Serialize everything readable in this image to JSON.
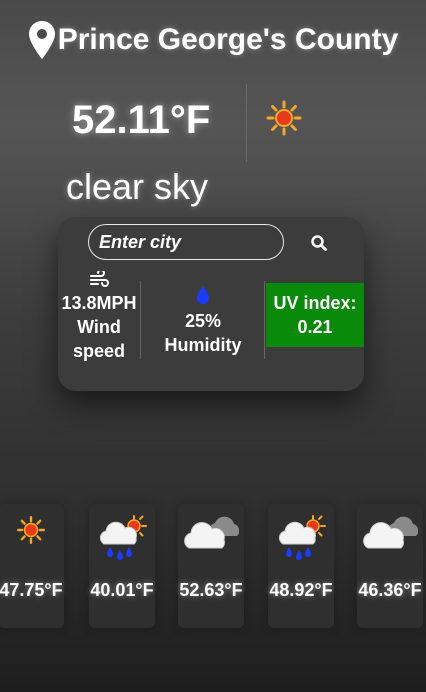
{
  "location": {
    "city": "Prince George's County",
    "icon": "map-pin-icon"
  },
  "current": {
    "temperature": "52.11°F",
    "description": "clear sky",
    "icon": "clear-sky-icon"
  },
  "search": {
    "placeholder": "Enter city",
    "button_icon": "search-icon"
  },
  "stats": {
    "wind": {
      "value": "13.8MPH",
      "label_line1": "Wind",
      "label_line2": "speed",
      "icon": "wind-icon"
    },
    "humidity": {
      "value": "25%",
      "label": "Humidity",
      "icon": "water-drop-icon"
    },
    "uv": {
      "label": "UV index:",
      "value": "0.21",
      "color": "#0a8a0a"
    }
  },
  "forecast": [
    {
      "temp": "47.75°F",
      "icon": "clear-sky-icon"
    },
    {
      "temp": "40.01°F",
      "icon": "rain-sun-cloud-icon"
    },
    {
      "temp": "52.63°F",
      "icon": "cloudy-icon"
    },
    {
      "temp": "48.92°F",
      "icon": "rain-sun-cloud-icon"
    },
    {
      "temp": "46.36°F",
      "icon": "cloudy-icon"
    }
  ]
}
